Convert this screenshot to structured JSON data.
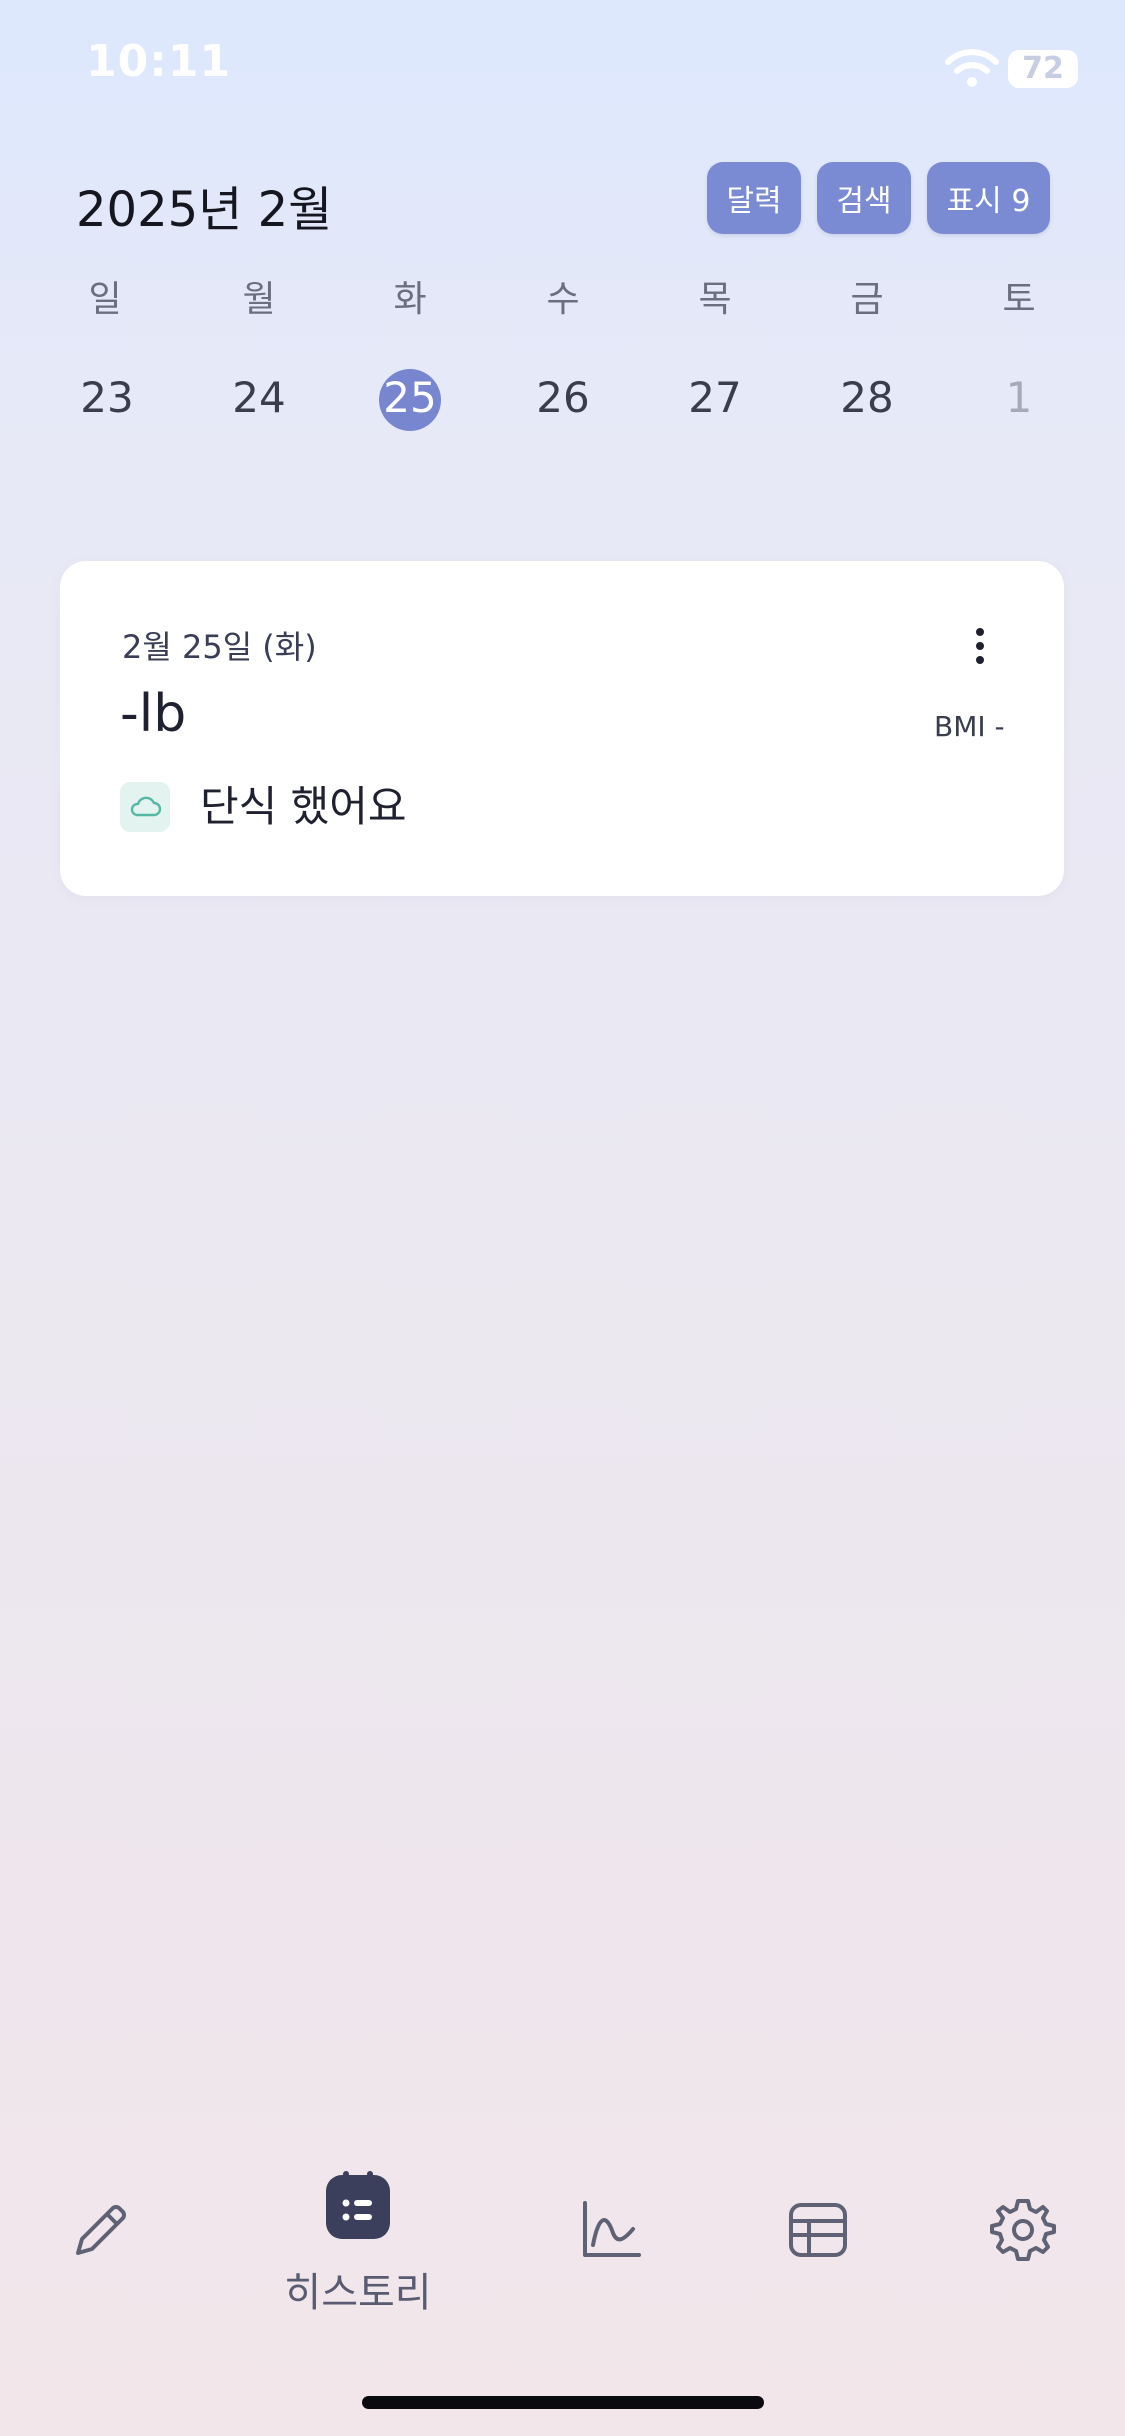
{
  "status_bar": {
    "time": "10:11",
    "battery": "72",
    "icons": [
      "wifi-icon",
      "battery-icon"
    ]
  },
  "header": {
    "month_title": "2025년 2월",
    "buttons": {
      "calendar": "달력",
      "search": "검색",
      "display": "표시 9"
    }
  },
  "week": {
    "weekdays": [
      "일",
      "월",
      "화",
      "수",
      "목",
      "금",
      "토"
    ],
    "days": [
      "23",
      "24",
      "25",
      "26",
      "27",
      "28",
      "1"
    ],
    "selected_day": "25"
  },
  "entry_card": {
    "date": "2월 25일 (화)",
    "weight": "-lb",
    "bmi": "BMI -",
    "diet_label": "단식 했어요",
    "icons": [
      "more-vertical-icon",
      "cloud-icon"
    ]
  },
  "bottom_nav": {
    "items": [
      {
        "icon": "pencil-icon",
        "label": ""
      },
      {
        "icon": "history-calendar-icon",
        "label": "히스토리",
        "active": true
      },
      {
        "icon": "chart-icon",
        "label": ""
      },
      {
        "icon": "table-icon",
        "label": ""
      },
      {
        "icon": "gear-icon",
        "label": ""
      }
    ]
  },
  "colors": {
    "accent": "#7b8bd3",
    "selected_day": "#7886cf",
    "nav_active": "#3b3f5c",
    "diet_icon_bg": "#e2f3f0",
    "diet_icon_stroke": "#57b7a5"
  }
}
